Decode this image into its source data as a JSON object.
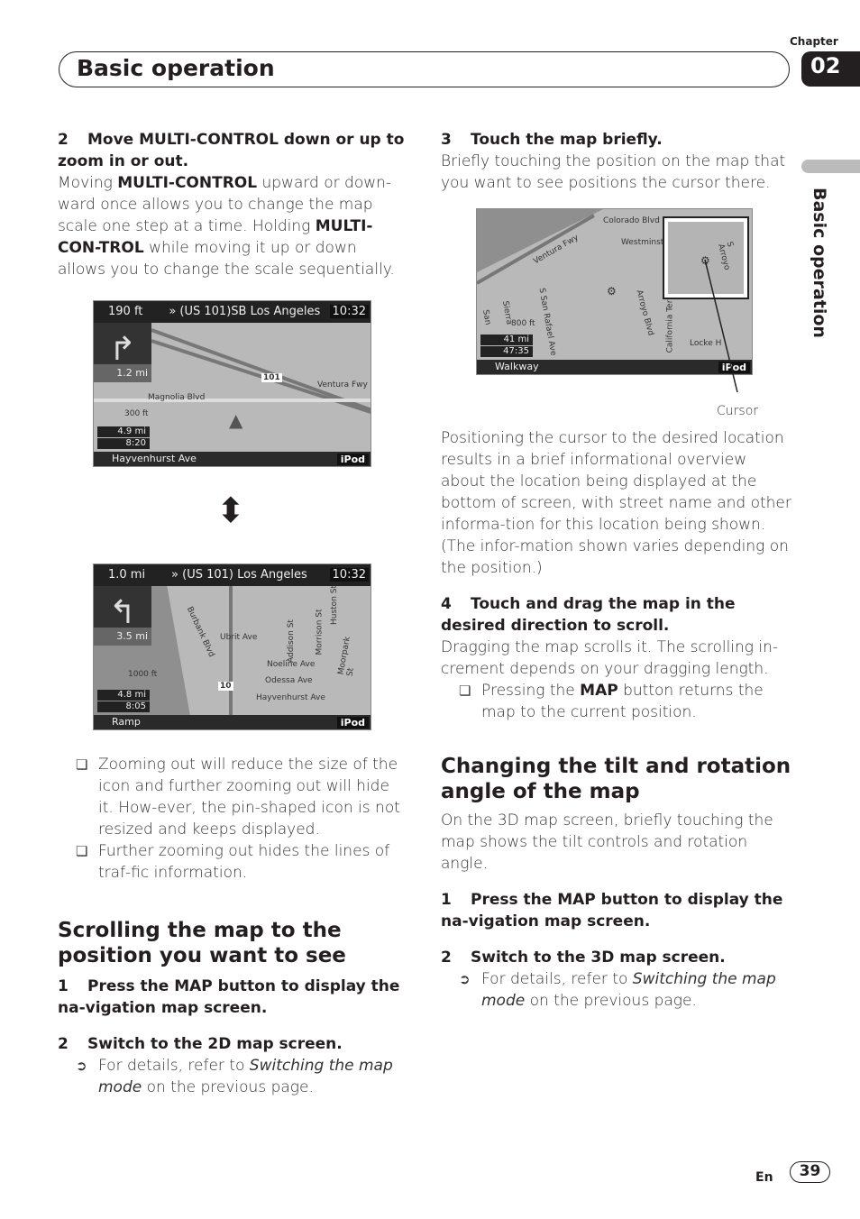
{
  "header": {
    "title": "Basic operation",
    "chapter_label": "Chapter",
    "chapter_number": "02",
    "side_tab": "Basic operation"
  },
  "left": {
    "step2_num": "2",
    "step2_title": "Move MULTI-CONTROL down or up to zoom in or out.",
    "step2_body": [
      {
        "t": "Moving "
      },
      {
        "b": "MULTI-CONTROL"
      },
      {
        "t": " upward or down-ward once allows you to change the map scale one step at a time. Holding "
      },
      {
        "b": "MULTI-CON-TROL"
      },
      {
        "t": " while moving it up or down allows you to change the scale sequentially."
      }
    ],
    "map1": {
      "distance": "190 ft",
      "road": "» (US 101)SB Los Angeles",
      "time": "10:32",
      "turn_dist": "1.2 mi",
      "shield": "101",
      "labels": [
        "Magnolia Blvd",
        "Ventura Fwy",
        "300 ft"
      ],
      "remaining": "4.9 mi",
      "eta": "8:20",
      "street": "Hayvenhurst Ave",
      "source": "iPod"
    },
    "map2": {
      "distance": "1.0 mi",
      "road": "» (US 101) Los Angeles",
      "time": "10:32",
      "turn_dist": "3.5 mi",
      "shield": "10",
      "labels": [
        "Burbank Blvd",
        "Ubrit Ave",
        "Addison St",
        "Morrison St",
        "Huston St",
        "Noeline Ave",
        "Odessa Ave",
        "Hayvenhurst Ave",
        "Moorpark St",
        "1000 ft"
      ],
      "remaining": "4.8 mi",
      "eta": "8:05",
      "street": "Ramp",
      "source": "iPod"
    },
    "notes": [
      "Zooming out will reduce the size of the icon and further zooming out will hide it. How-ever, the pin-shaped icon is not resized and keeps displayed.",
      "Further zooming out hides the lines of traf-fic information."
    ],
    "section_title": "Scrolling the map to the position you want to see",
    "s1_num": "1",
    "s1_title": "Press the MAP button to display the na-vigation map screen.",
    "s2_num": "2",
    "s2_title": "Switch to the 2D map screen.",
    "s2_ref_prefix": "For details, refer to ",
    "s2_ref_italic": "Switching the map mode",
    "s2_ref_suffix": "on the previous page."
  },
  "right": {
    "step3_num": "3",
    "step3_title": "Touch the map briefly.",
    "step3_body": "Briefly touching the position on the map that you want to see positions the cursor there.",
    "map3": {
      "labels": [
        "Colorado Blvd",
        "Ventura Fwy",
        "Westminster",
        "S San Rafael Ave",
        "Sierra",
        "San",
        "Arroyo Blvd",
        "California Ter",
        "Locke H",
        "S Arroyo",
        "800 ft"
      ],
      "remaining": "41 mi",
      "eta": "47:35",
      "street": "Walkway",
      "source": "iPod"
    },
    "cursor_label": "Cursor",
    "step3_body2": "Positioning the cursor to the desired location results in a brief informational overview about the location being displayed at the bottom of screen, with street name and other informa-tion for this location being shown. (The infor-mation shown varies depending on the position.)",
    "step4_num": "4",
    "step4_title": "Touch and drag the map in the desired direction to scroll.",
    "step4_body": "Dragging the map scrolls it. The scrolling in-crement depends on your dragging length.",
    "step4_note_pre": "Pressing the ",
    "step4_note_b": "MAP",
    "step4_note_post": " button returns the map to the current position.",
    "section_title": "Changing the tilt and rotation angle of the map",
    "section_body": "On the 3D map screen, briefly touching the map shows the tilt controls and rotation angle.",
    "s1_num": "1",
    "s1_title": "Press the MAP button to display the na-vigation map screen.",
    "s2_num": "2",
    "s2_title": "Switch to the 3D map screen.",
    "s2_ref_prefix": "For details, refer to ",
    "s2_ref_italic": "Switching the map mode",
    "s2_ref_suffix": "on the previous page."
  },
  "footer": {
    "lang": "En",
    "page": "39"
  }
}
